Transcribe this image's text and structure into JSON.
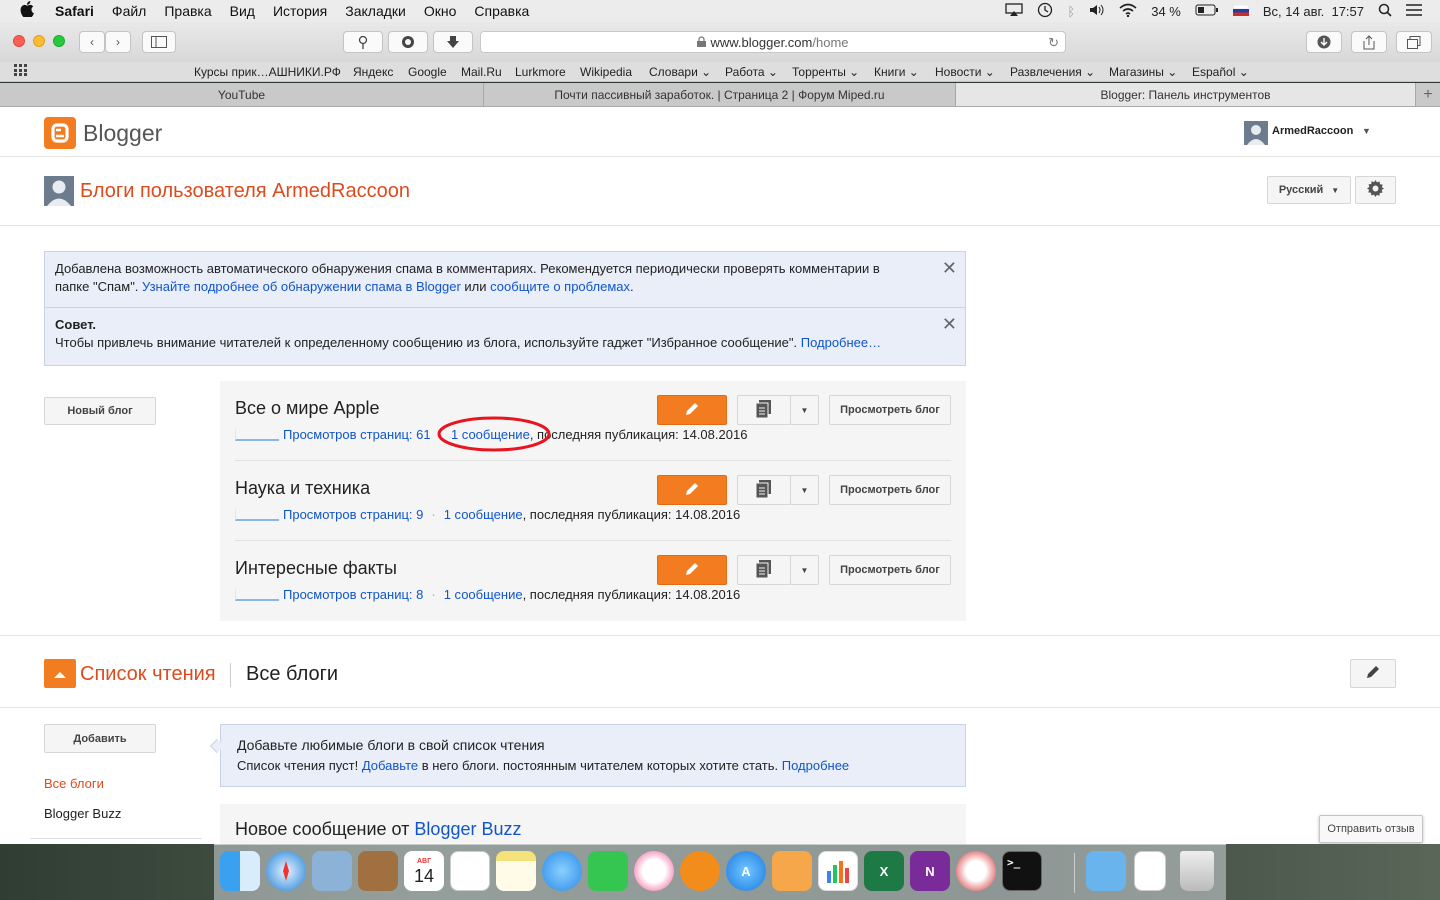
{
  "menubar": {
    "apple": "",
    "app": "Safari",
    "items": [
      "Файл",
      "Правка",
      "Вид",
      "История",
      "Закладки",
      "Окно",
      "Справка"
    ],
    "battery": "34 %",
    "datetime": "Вс, 14 авг.  17:57"
  },
  "toolbar": {
    "url_domain": "www.blogger.com",
    "url_path": "/home"
  },
  "bookmarks": [
    "Курсы прик…АШНИКИ.РФ",
    "Яндекс",
    "Google",
    "Mail.Ru",
    "Lurkmore",
    "Wikipedia",
    "Словари ⌄",
    "Работа ⌄",
    "Торренты ⌄",
    "Книги ⌄",
    "Новости ⌄",
    "Развлечения ⌄",
    "Магазины ⌄",
    "Español ⌄"
  ],
  "tabs": [
    "YouTube",
    "Почти пассивный заработок. | Страница 2 | Форум Miped.ru",
    "Blogger: Панель инструментов"
  ],
  "blogger": {
    "logo_text": "Blogger",
    "username": "ArmedRaccoon",
    "page_title": "Блоги пользователя ArmedRaccoon",
    "language": "Русский",
    "notice1": {
      "text1": "Добавлена возможность автоматического обнаружения спама в комментариях. Рекомендуется периодически проверять комментарии в папке \"Спам\". ",
      "link1": "Узнайте подробнее об обнаружении спама в Blogger",
      "text2": " или ",
      "link2": "сообщите о проблемах",
      "text3": "."
    },
    "notice2": {
      "title": "Совет.",
      "text": "Чтобы привлечь внимание читателей к определенному сообщению из блога, используйте гаджет \"Избранное сообщение\". ",
      "link": "Подробнее…"
    },
    "new_blog_button": "Новый блог",
    "view_blog_label": "Просмотреть блог",
    "blogs": [
      {
        "title": "Все о мире Apple",
        "views": "Просмотров страниц: 61",
        "posts": "1 сообщение",
        "last": ", последняя публикация: 14.08.2016"
      },
      {
        "title": "Наука и техника",
        "views": "Просмотров страниц: 9",
        "posts": "1 сообщение",
        "last": ", последняя публикация: 14.08.2016"
      },
      {
        "title": "Интересные факты",
        "views": "Просмотров страниц: 8",
        "posts": "1 сообщение",
        "last": ", последняя публикация: 14.08.2016"
      }
    ],
    "reading_list": {
      "title": "Список чтения",
      "all_blogs_header": "Все блоги",
      "add_button": "Добавить",
      "sidebar": [
        "Все блоги",
        "Blogger Buzz"
      ],
      "info_title": "Добавьте любимые блоги в свой список чтения",
      "info_text1": "Список чтения пуст! ",
      "info_link1": "Добавьте",
      "info_text2": " в него блоги. постоянным читателем которых хотите стать. ",
      "info_link2": "Подробнее",
      "new_post_prefix": "Новое сообщение от ",
      "new_post_link": "Blogger Buzz"
    },
    "feedback_button": "Отправить отзыв"
  },
  "dock": {
    "calendar_month": "АВГ",
    "calendar_day": "14",
    "apps": [
      "Finder",
      "Safari",
      "Preview",
      "Contacts",
      "Calendar",
      "Reminders",
      "Notes",
      "Messages",
      "FaceTime",
      "iTunes",
      "iBooks",
      "App Store",
      "Pages",
      "Numbers",
      "Excel",
      "OneNote",
      "Parallels",
      "Terminal",
      "Downloads",
      "Document",
      "Trash"
    ]
  },
  "colors": {
    "accent": "#f37b20",
    "link": "#1155cc",
    "annotation": "#e8141f"
  }
}
